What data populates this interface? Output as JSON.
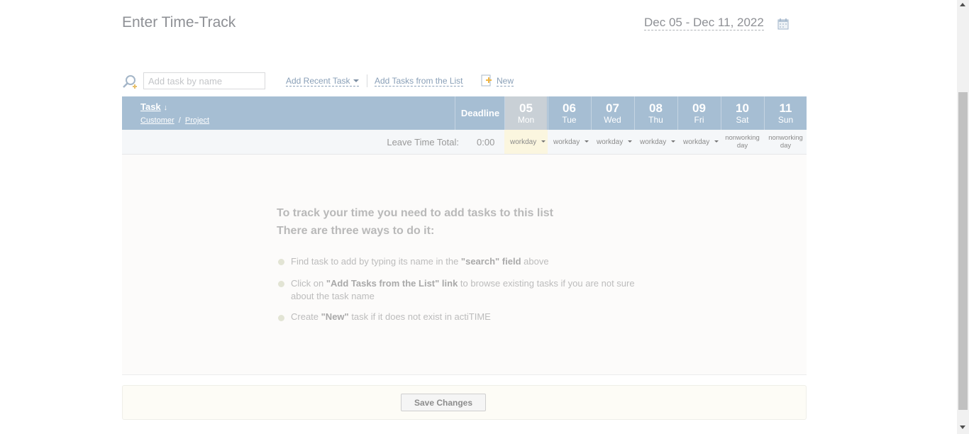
{
  "header": {
    "title": "Enter Time-Track",
    "date_range": "Dec 05 - Dec 11, 2022"
  },
  "toolbar": {
    "search_placeholder": "Add task by name",
    "add_recent": "Add Recent Task",
    "add_from_list": "Add Tasks from the List",
    "new": "New"
  },
  "grid": {
    "task_header": "Task",
    "customer": "Customer",
    "separator": "/",
    "project": "Project",
    "deadline": "Deadline",
    "days": [
      {
        "num": "05",
        "name": "Mon"
      },
      {
        "num": "06",
        "name": "Tue"
      },
      {
        "num": "07",
        "name": "Wed"
      },
      {
        "num": "08",
        "name": "Thu"
      },
      {
        "num": "09",
        "name": "Fri"
      },
      {
        "num": "10",
        "name": "Sat"
      },
      {
        "num": "11",
        "name": "Sun"
      }
    ],
    "leave_label": "Leave Time Total:",
    "leave_total": "0:00",
    "leave_cells": [
      "workday",
      "workday",
      "workday",
      "workday",
      "workday",
      "nonworking day",
      "nonworking day"
    ]
  },
  "empty_state": {
    "line1": "To track your time you need to add tasks to this list",
    "line2": "There are three ways to do it:",
    "tip1_pre": "Find task to add by typing its name in the ",
    "tip1_bold": "\"search\" field",
    "tip1_post": " above",
    "tip2_pre": "Click on ",
    "tip2_bold": "\"Add Tasks from the List\" link",
    "tip2_post": " to browse existing tasks if you are not sure about the task name",
    "tip3_pre": "Create ",
    "tip3_bold": "\"New\"",
    "tip3_post": " task if it does not exist in actiTIME"
  },
  "footer": {
    "save_label": "Save Changes"
  },
  "colors": {
    "header_bg": "#a6bed3",
    "today_col": "#c9d0d6",
    "today_leave": "#fbf6df"
  }
}
